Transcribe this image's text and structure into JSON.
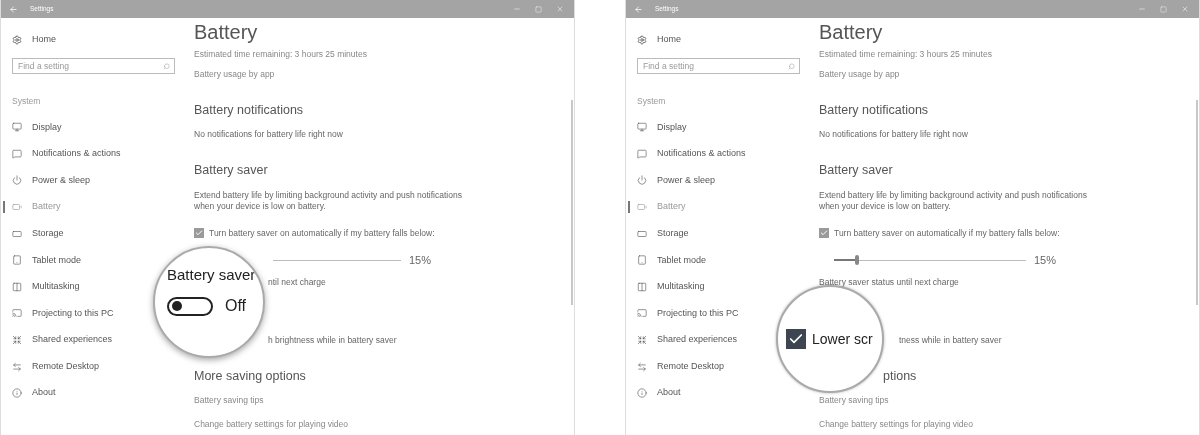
{
  "panels": [
    {
      "window": {
        "title": "Settings"
      },
      "sidebar": {
        "home": "Home",
        "search": {
          "placeholder": "Find a setting"
        },
        "section": "System",
        "items": [
          {
            "label": "Display",
            "selected": false
          },
          {
            "label": "Notifications & actions",
            "selected": false
          },
          {
            "label": "Power & sleep",
            "selected": false
          },
          {
            "label": "Battery",
            "selected": true
          },
          {
            "label": "Storage",
            "selected": false
          },
          {
            "label": "Tablet mode",
            "selected": false
          },
          {
            "label": "Multitasking",
            "selected": false
          },
          {
            "label": "Projecting to this PC",
            "selected": false
          },
          {
            "label": "Shared experiences",
            "selected": false
          },
          {
            "label": "Remote Desktop",
            "selected": false
          },
          {
            "label": "About",
            "selected": false
          }
        ]
      },
      "content": [
        {
          "kind": "title",
          "text": "Battery"
        },
        {
          "kind": "note",
          "text": "Estimated time remaining: 3 hours 25 minutes"
        },
        {
          "kind": "link",
          "text": "Battery usage by app"
        },
        {
          "kind": "heading",
          "text": "Battery notifications"
        },
        {
          "kind": "text",
          "text": "No notifications for battery life right now"
        },
        {
          "kind": "heading",
          "text": "Battery saver"
        },
        {
          "kind": "paragraph",
          "text": "Extend battery life by limiting background activity and push notifications when your device is low on battery."
        },
        {
          "kind": "checkbox",
          "text": "Turn battery saver on automatically if my battery falls below:",
          "checked": true
        },
        {
          "kind": "slider",
          "reading": "15%"
        },
        {
          "kind": "text",
          "text": "ntil next charge"
        },
        {
          "kind": "text",
          "text": "h brightness while in battery saver"
        },
        {
          "kind": "heading",
          "text": "More saving options"
        },
        {
          "kind": "link",
          "text": "Battery saving tips"
        },
        {
          "kind": "link",
          "text": "Change battery settings for playing video"
        }
      ],
      "magnifier": {
        "kind": "toggle",
        "label": "Battery saver",
        "on": false,
        "state_text": "Off"
      }
    },
    {
      "window": {
        "title": "Settings"
      },
      "sidebar": {
        "home": "Home",
        "search": {
          "placeholder": "Find a setting"
        },
        "section": "System",
        "items": [
          {
            "label": "Display",
            "selected": false
          },
          {
            "label": "Notifications & actions",
            "selected": false
          },
          {
            "label": "Power & sleep",
            "selected": false
          },
          {
            "label": "Battery",
            "selected": true
          },
          {
            "label": "Storage",
            "selected": false
          },
          {
            "label": "Tablet mode",
            "selected": false
          },
          {
            "label": "Multitasking",
            "selected": false
          },
          {
            "label": "Projecting to this PC",
            "selected": false
          },
          {
            "label": "Shared experiences",
            "selected": false
          },
          {
            "label": "Remote Desktop",
            "selected": false
          },
          {
            "label": "About",
            "selected": false
          }
        ]
      },
      "content": [
        {
          "kind": "title",
          "text": "Battery"
        },
        {
          "kind": "note",
          "text": "Estimated time remaining: 3 hours 25 minutes"
        },
        {
          "kind": "link",
          "text": "Battery usage by app"
        },
        {
          "kind": "heading",
          "text": "Battery notifications"
        },
        {
          "kind": "text",
          "text": "No notifications for battery life right now"
        },
        {
          "kind": "heading",
          "text": "Battery saver"
        },
        {
          "kind": "paragraph",
          "text": "Extend battery life by limiting background activity and push notifications when your device is low on battery."
        },
        {
          "kind": "checkbox",
          "text": "Turn battery saver on automatically if my battery falls below:",
          "checked": true
        },
        {
          "kind": "slider",
          "reading": "15%",
          "level": 0.12
        },
        {
          "kind": "text",
          "text": "Battery saver status until next charge"
        },
        {
          "kind": "text",
          "text": "tness while in battery saver"
        },
        {
          "kind": "heading",
          "text": "ptions"
        },
        {
          "kind": "link",
          "text": "Battery saving tips"
        },
        {
          "kind": "link",
          "text": "Change battery settings for playing video"
        }
      ],
      "magnifier": {
        "kind": "checkbox",
        "label": "Lower scr",
        "checked": true
      }
    }
  ]
}
